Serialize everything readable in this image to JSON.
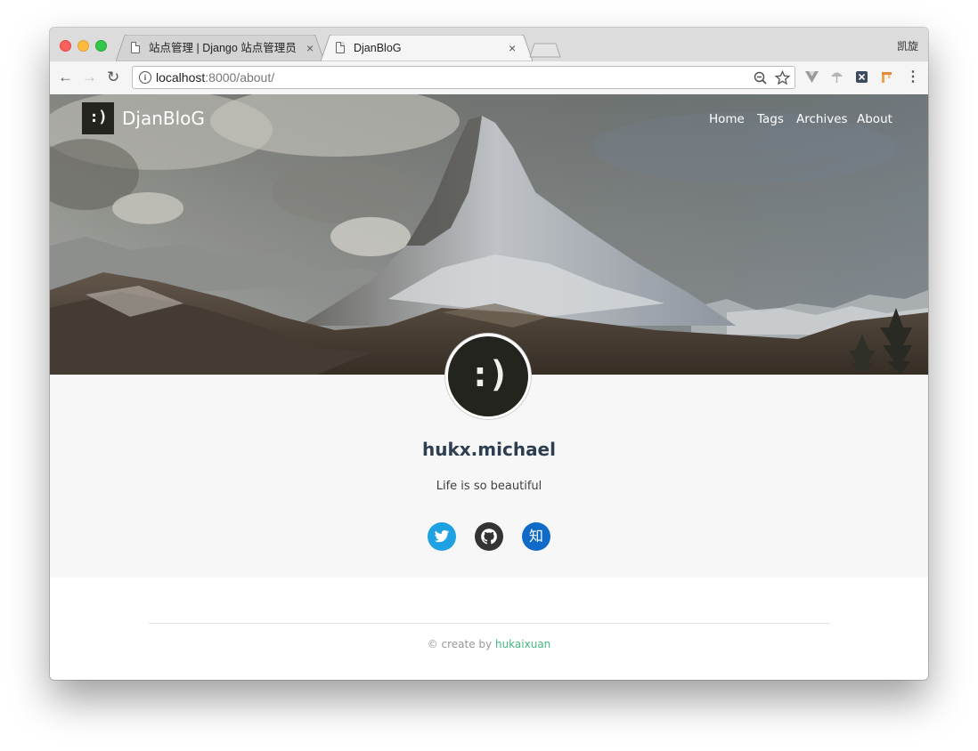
{
  "browser": {
    "tabs": [
      {
        "title": "站点管理 | Django 站点管理员",
        "close": "×"
      },
      {
        "title": "DjanBloG",
        "close": "×"
      }
    ],
    "profile": "凯旋",
    "url_host": "localhost",
    "url_path": ":8000/about/"
  },
  "site": {
    "logo": ":)",
    "brand": "DjanBloG",
    "nav": [
      "Home",
      "Tags",
      "Archives",
      "About"
    ]
  },
  "about": {
    "avatar": ":)",
    "name": "hukx.michael",
    "bio": "Life is so beautiful",
    "social": [
      {
        "name": "twitter",
        "color": "#1da1e2"
      },
      {
        "name": "github",
        "color": "#333333"
      },
      {
        "name": "zhihu",
        "label": "知",
        "color": "#0f6bc7"
      }
    ]
  },
  "footer": {
    "prefix": "© create by ",
    "author": "hukaixuan"
  }
}
